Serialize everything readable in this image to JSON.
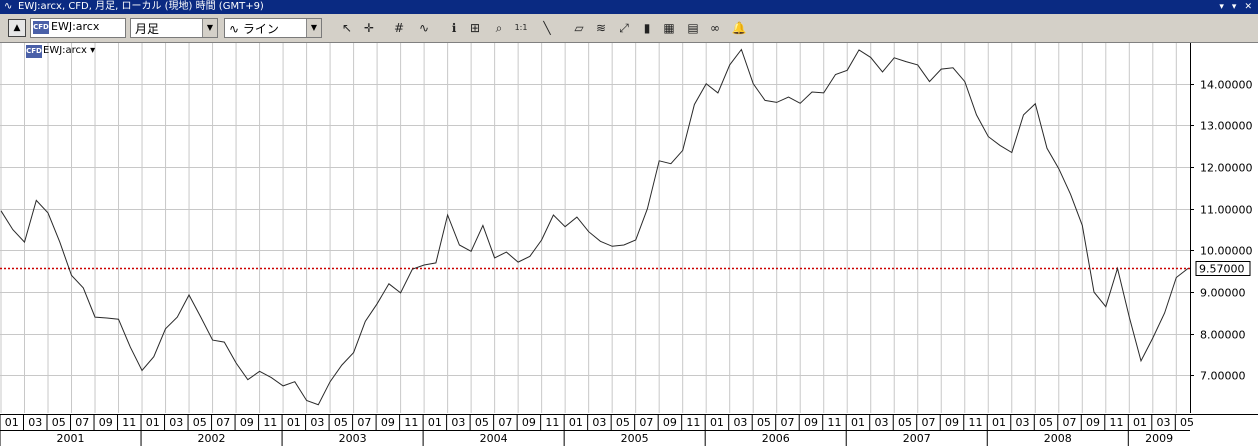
{
  "window": {
    "title": "EWJ:arcx, CFD, 月足, ローカル (現地) 時間 (GMT+9)",
    "controls": [
      "▾",
      "▾",
      "✕"
    ]
  },
  "toolbar": {
    "symbol": "EWJ:arcx",
    "symbol_badge": "CFD",
    "period": "月足",
    "style": "ライン",
    "icons": [
      "cursor-icon",
      "crosshair-icon",
      "grid-icon",
      "indicator-icon",
      "info-icon",
      "data-window-icon",
      "zoom-icon",
      "ratio-icon",
      "line-tool-icon",
      "eraser-icon",
      "fibonacci-icon",
      "scale-icon",
      "candles-icon",
      "chart-properties-icon",
      "template-icon",
      "link-icon",
      "alert-bell-icon"
    ]
  },
  "legend": {
    "label": "EWJ:arcx ▾",
    "badge": "CFD"
  },
  "chart_data": {
    "type": "line",
    "x_start": "2001-01",
    "frequency": "monthly",
    "series": [
      {
        "values": [
          10.95,
          10.5,
          10.2,
          11.2,
          10.9,
          10.2,
          9.4,
          9.1,
          8.4,
          8.38,
          8.35,
          7.68,
          7.12,
          7.45,
          8.12,
          8.4,
          8.93,
          8.4,
          7.85,
          7.8,
          7.3,
          6.9,
          7.1,
          6.95,
          6.75,
          6.85,
          6.4,
          6.3,
          6.85,
          7.25,
          7.55,
          8.3,
          8.72,
          9.2,
          8.98,
          9.55,
          9.65,
          9.7,
          10.85,
          10.13,
          9.98,
          10.6,
          9.82,
          9.96,
          9.72,
          9.86,
          10.25,
          10.85,
          10.57,
          10.8,
          10.45,
          10.22,
          10.1,
          10.13,
          10.25,
          11.0,
          12.15,
          12.08,
          12.4,
          13.5,
          14.0,
          13.78,
          14.45,
          14.82,
          14.0,
          13.6,
          13.55,
          13.68,
          13.53,
          13.8,
          13.78,
          14.22,
          14.32,
          14.81,
          14.63,
          14.28,
          14.62,
          14.53,
          14.45,
          14.05,
          14.35,
          14.38,
          14.05,
          13.25,
          12.73,
          12.52,
          12.35,
          13.25,
          13.52,
          12.45,
          11.96,
          11.35,
          10.6,
          9.0,
          8.65,
          9.57,
          8.4,
          7.35,
          7.9,
          8.5,
          9.35,
          9.57
        ]
      }
    ],
    "y_ticks": [
      "7.00000",
      "8.00000",
      "9.00000",
      "10.00000",
      "11.00000",
      "12.00000",
      "13.00000",
      "14.00000"
    ],
    "ylim": [
      6.1,
      15.0
    ],
    "last_value": 9.57,
    "last_value_label": "9.57000",
    "month_labels": [
      "01",
      "03",
      "05",
      "07",
      "09",
      "11"
    ],
    "years": [
      "2001",
      "2002",
      "2003",
      "2004",
      "2005",
      "2006",
      "2007",
      "2008",
      "2009"
    ],
    "grid": true,
    "colors": {
      "line": "#2a2a2a",
      "hline": "#cc0000",
      "grid": "#c8c8c8"
    }
  }
}
